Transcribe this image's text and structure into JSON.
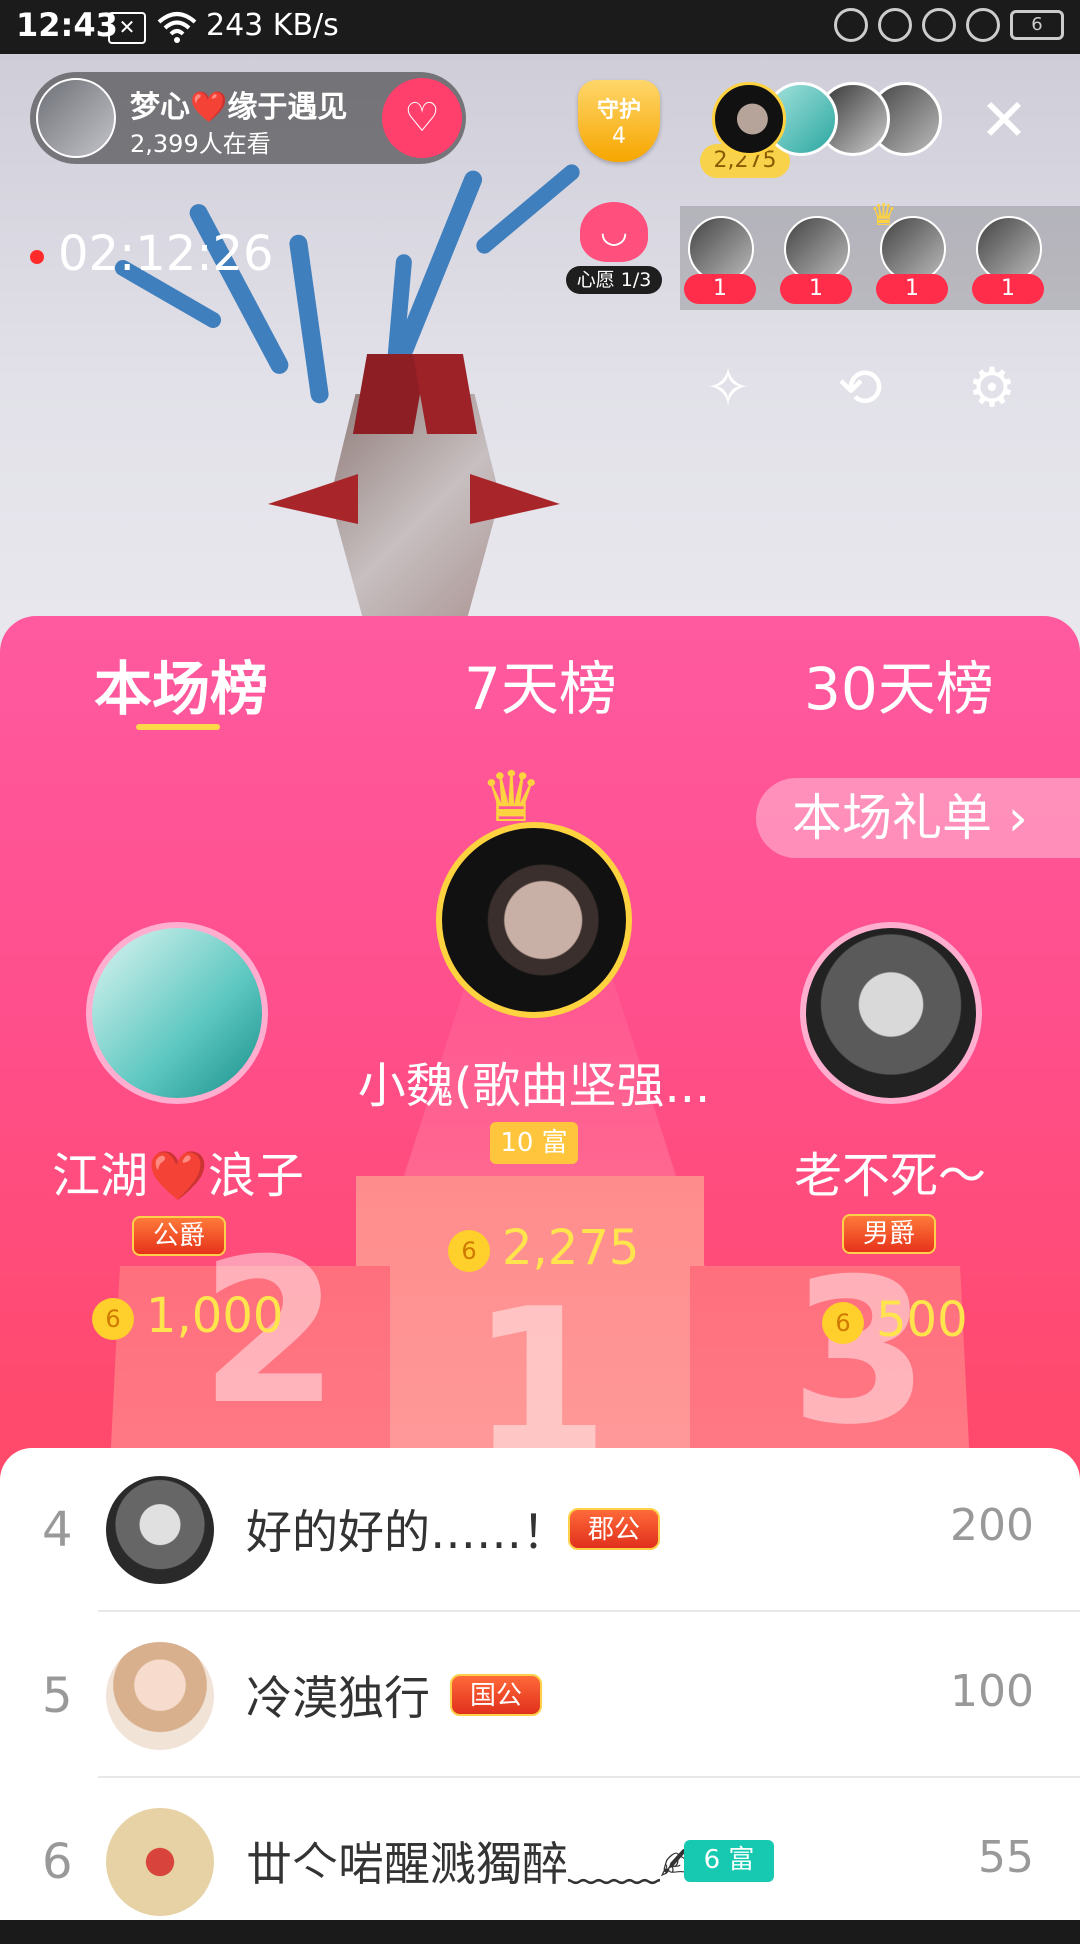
{
  "status_bar": {
    "time": "12:43",
    "speed": "243 KB/s",
    "battery": "6"
  },
  "host": {
    "name": "梦心❤️缘于遇见",
    "viewers": "2,399人在看"
  },
  "guard": {
    "label": "守护",
    "count": "4"
  },
  "top_contrib_count": "2,275",
  "live_timer": "02:12:26",
  "wish": {
    "label": "心愿 1/3"
  },
  "rank_strip_badges": [
    "1",
    "1",
    "1",
    "1"
  ],
  "tabs": [
    "本场榜",
    "7天榜",
    "30天榜"
  ],
  "gift_list_button": "本场礼单 ›",
  "podium": {
    "first": {
      "name": "小魏(歌曲坚强...",
      "badge": "10 富",
      "coins": "2,275"
    },
    "second": {
      "name": "江湖❤️浪子",
      "badge": "公爵",
      "coins": "1,000"
    },
    "third": {
      "name": "老不死～",
      "badge": "男爵",
      "coins": "500"
    },
    "numbers": [
      "2",
      "1",
      "3"
    ]
  },
  "ranking_list": [
    {
      "rank": "4",
      "name": "好的好的……！",
      "badge": "郡公",
      "score": "200"
    },
    {
      "rank": "5",
      "name": "冷漠独行",
      "badge": "国公",
      "score": "100"
    },
    {
      "rank": "6",
      "name": "丗亽啱醒溅獨醉﹏﹏✍",
      "badge": "6 富",
      "score": "55"
    }
  ],
  "colors": {
    "panel_top": "#ff5aa0",
    "panel_bottom": "#ff4d5d",
    "coin_text": "#ffe44d",
    "tab_underline": "#ffd84a",
    "follow_button": "#ff3f6c"
  }
}
